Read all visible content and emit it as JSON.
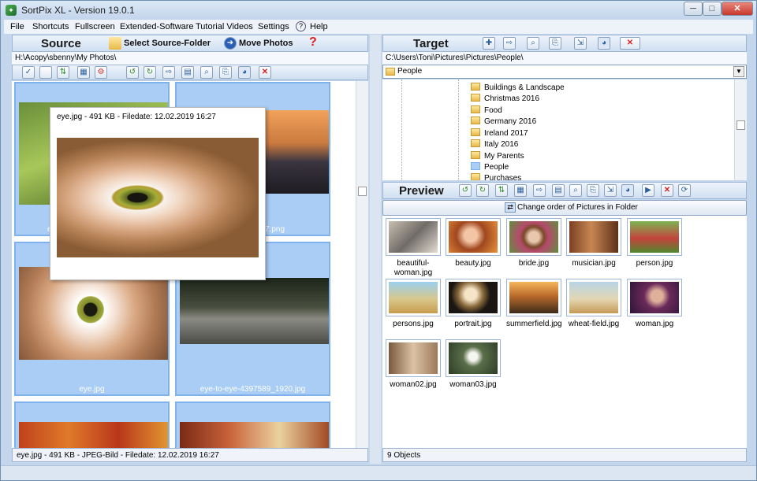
{
  "window": {
    "title": "SortPix XL - Version 19.0.1",
    "minimize": "─",
    "maximize": "□",
    "close": "✕"
  },
  "menu": [
    "File",
    "Shortcuts",
    "Fullscreen",
    "Extended-Software",
    "Tutorial Videos",
    "Settings",
    "Help"
  ],
  "source": {
    "header": "Source",
    "select_folder": "Select Source-Folder",
    "move_photos": "Move Photos",
    "help": "?",
    "path": "H:\\Acopy\\sbenny\\My Photos\\",
    "thumbs": [
      {
        "label": "eye.jpg"
      },
      {
        "label": "eye.png"
      },
      {
        "label": "eye.jpg"
      },
      {
        "label": "eye-to-eye-4397589_1920.jpg"
      },
      {
        "label": ""
      },
      {
        "label": ""
      }
    ],
    "tooltip": "eye.jpg - 491 KB - Filedate: 12.02.2019 16:27",
    "status": "eye.jpg - 491 KB - JPEG-Bild - Filedate: 12.02.2019 16:27",
    "partial_label_left": "e",
    "partial_label_right": "7.png"
  },
  "target": {
    "header": "Target",
    "path": "C:\\Users\\Toni\\Pictures\\Pictures\\People\\",
    "folder_select": "People",
    "tree": [
      "Buildings & Landscape",
      "Christmas 2016",
      "Food",
      "Germany 2016",
      "Ireland 2017",
      "Italy 2016",
      "My Parents",
      "People",
      "Purchases"
    ]
  },
  "preview": {
    "header": "Preview",
    "change_order": "Change order of Pictures in Folder",
    "items": [
      "beautiful-woman.jpg",
      "beauty.jpg",
      "bride.jpg",
      "musician.jpg",
      "person.jpg",
      "persons.jpg",
      "portrait.jpg",
      "summerfield.jpg",
      "wheat-field.jpg",
      "woman.jpg",
      "woman02.jpg",
      "woman03.jpg"
    ],
    "status": "9 Objects"
  },
  "colors": {
    "accent": "#7fb2ec",
    "selection": "#a9cdf5",
    "close": "#c9433a"
  }
}
